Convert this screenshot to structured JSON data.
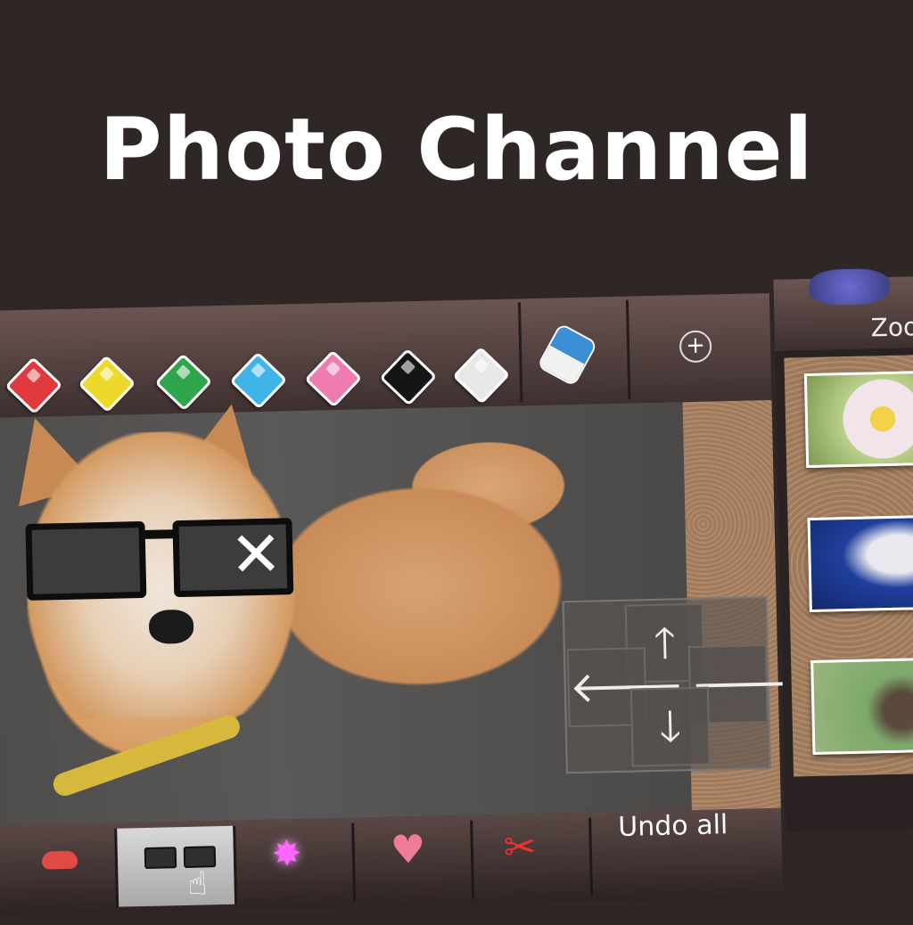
{
  "title": "Photo Channel",
  "toolbar": {
    "pencils": [
      {
        "name": "red-pencil",
        "color": "#e03a3e"
      },
      {
        "name": "yellow-pencil",
        "color": "#ecd92a"
      },
      {
        "name": "green-pencil",
        "color": "#2fa64b"
      },
      {
        "name": "blue-pencil",
        "color": "#3eb5e6"
      },
      {
        "name": "pink-pencil",
        "color": "#ee7cb2"
      },
      {
        "name": "black-pencil",
        "color": "#151515"
      },
      {
        "name": "white-pencil",
        "color": "#e8e8e8"
      }
    ],
    "eraser_icon": "eraser-icon",
    "zoom_in_symbol": "+"
  },
  "dpad": {
    "up": "🡑",
    "down": "🡓",
    "left": "🡐",
    "right": "🡒"
  },
  "stamps": {
    "glasses_sparkle": "✕"
  },
  "bottombar": {
    "lips_icon": "lips-icon",
    "sunglasses_icon": "sunglasses-icon",
    "pointer": "☝",
    "sparkle": "✸",
    "heart": "♥",
    "scissors": "✂",
    "undo_all": "Undo all"
  },
  "rightpanel": {
    "zoom_label": "Zoo"
  }
}
